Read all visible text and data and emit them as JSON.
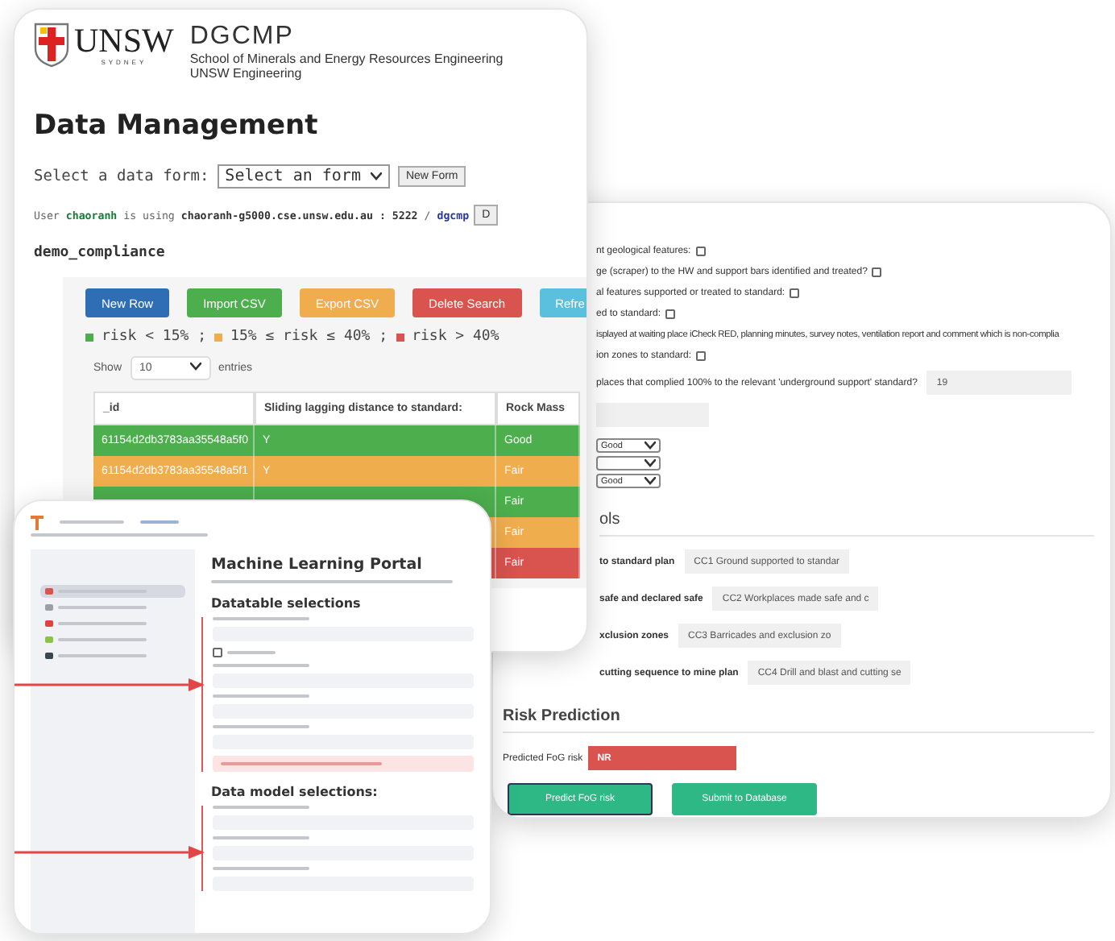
{
  "data_management": {
    "logo": {
      "wordmark": "UNSW",
      "subtitle": "SYDNEY"
    },
    "app_name": "DGCMP",
    "school": "School of Minerals and Energy Resources Engineering",
    "faculty": "UNSW Engineering",
    "title": "Data Management",
    "form_select": {
      "label": "Select a data form:",
      "value": "Select an form"
    },
    "new_form_button": "New Form",
    "user_line": {
      "prefix": "User",
      "user": "chaoranh",
      "middle": "is using",
      "host": "chaoranh-g5000.cse.unsw.edu.au : 5222",
      "separator": "/",
      "database": "dgcmp",
      "button": "D"
    },
    "dataset": "demo_compliance",
    "actions": [
      {
        "label": "New Row",
        "color": "#2f6db5"
      },
      {
        "label": "Import CSV",
        "color": "#4cae4c"
      },
      {
        "label": "Export CSV",
        "color": "#f0ad4e"
      },
      {
        "label": "Delete Search",
        "color": "#d9534f"
      },
      {
        "label": "Refre",
        "color": "#5bc0de"
      }
    ],
    "legend": [
      {
        "label": "risk < 15% ;",
        "color": "#4cae4c"
      },
      {
        "label": "15% ≤ risk ≤ 40% ;",
        "color": "#f0ad4e"
      },
      {
        "label": "risk > 40%",
        "color": "#d9534f"
      }
    ],
    "page_length": {
      "prefix": "Show",
      "value": "10",
      "suffix": "entries"
    },
    "table": {
      "columns": [
        "_id",
        "Sliding lagging distance to standard:",
        "Rock Mass"
      ],
      "rows": [
        {
          "color": "#4cae4c",
          "cells": [
            "61154d2db3783aa35548a5f0",
            "Y",
            "Good"
          ]
        },
        {
          "color": "#f0ad4e",
          "cells": [
            "61154d2db3783aa35548a5f1",
            "Y",
            "Fair"
          ]
        },
        {
          "color": "#4cae4c",
          "cells": [
            null,
            null,
            "Fair"
          ]
        },
        {
          "color": "#f0ad4e",
          "cells": [
            null,
            null,
            "Fair"
          ]
        },
        {
          "color": "#d9534f",
          "cells": [
            null,
            null,
            "Fair"
          ]
        }
      ]
    }
  },
  "compliance_form": {
    "questions": [
      {
        "kind": "checkbox",
        "text": "nt geological features:",
        "checked": false
      },
      {
        "kind": "checkbox",
        "text": "ge (scraper) to the HW and support bars identified and treated?",
        "checked": false
      },
      {
        "kind": "checkbox",
        "text": "al features supported or treated to standard:",
        "checked": false
      },
      {
        "kind": "checkbox",
        "text": "ed to standard:",
        "checked": false
      },
      {
        "kind": "note",
        "text": "isplayed at waiting place iCheck RED, planning minutes, survey notes, ventilation report and comment which is non-complia"
      },
      {
        "kind": "checkbox",
        "text": "ion zones to standard:",
        "checked": false
      },
      {
        "kind": "input",
        "text": "places that complied 100% to the relevant 'underground support' standard?",
        "value": "19"
      },
      {
        "kind": "input"
      }
    ],
    "selects": [
      {
        "kind": "filled",
        "value": "Good"
      },
      {
        "kind": "empty"
      },
      {
        "kind": "filled",
        "value": "Good"
      }
    ],
    "controls_heading": "ols",
    "controls": [
      {
        "label": "to standard plan",
        "value": "CC1 Ground supported to standar"
      },
      {
        "label": "safe and declared safe",
        "value": "CC2 Workplaces made safe and c"
      },
      {
        "label": "xclusion zones",
        "value": "CC3 Barricades and exclusion zo"
      },
      {
        "label": "cutting sequence to mine plan",
        "value": "CC4 Drill and blast and cutting se"
      }
    ],
    "risk_heading": "Risk Prediction",
    "predicted": {
      "label": "Predicted FoG risk",
      "value": "NR"
    },
    "buttons": [
      "Predict FoG risk",
      "Submit to Database"
    ]
  },
  "ml_portal": {
    "sidebar_items": [
      {
        "selected": true,
        "color": "#d9534f"
      },
      {
        "selected": false,
        "color": "#9aa0a6"
      },
      {
        "selected": false,
        "color": "#e0433f"
      },
      {
        "selected": false,
        "color": "#8bc34a"
      },
      {
        "selected": false,
        "color": "#37474f"
      }
    ],
    "title": "Machine Learning Portal",
    "sections": [
      {
        "heading": "Datatable selections",
        "fields": [
          {
            "kind": "select"
          },
          {
            "kind": "checkbox",
            "checked": false
          },
          {
            "kind": "select"
          },
          {
            "kind": "select"
          },
          {
            "kind": "select"
          },
          {
            "kind": "alert"
          }
        ]
      },
      {
        "heading": "Data model selections:",
        "fields": [
          {
            "kind": "select"
          },
          {
            "kind": "select"
          },
          {
            "kind": "select"
          }
        ]
      }
    ]
  }
}
